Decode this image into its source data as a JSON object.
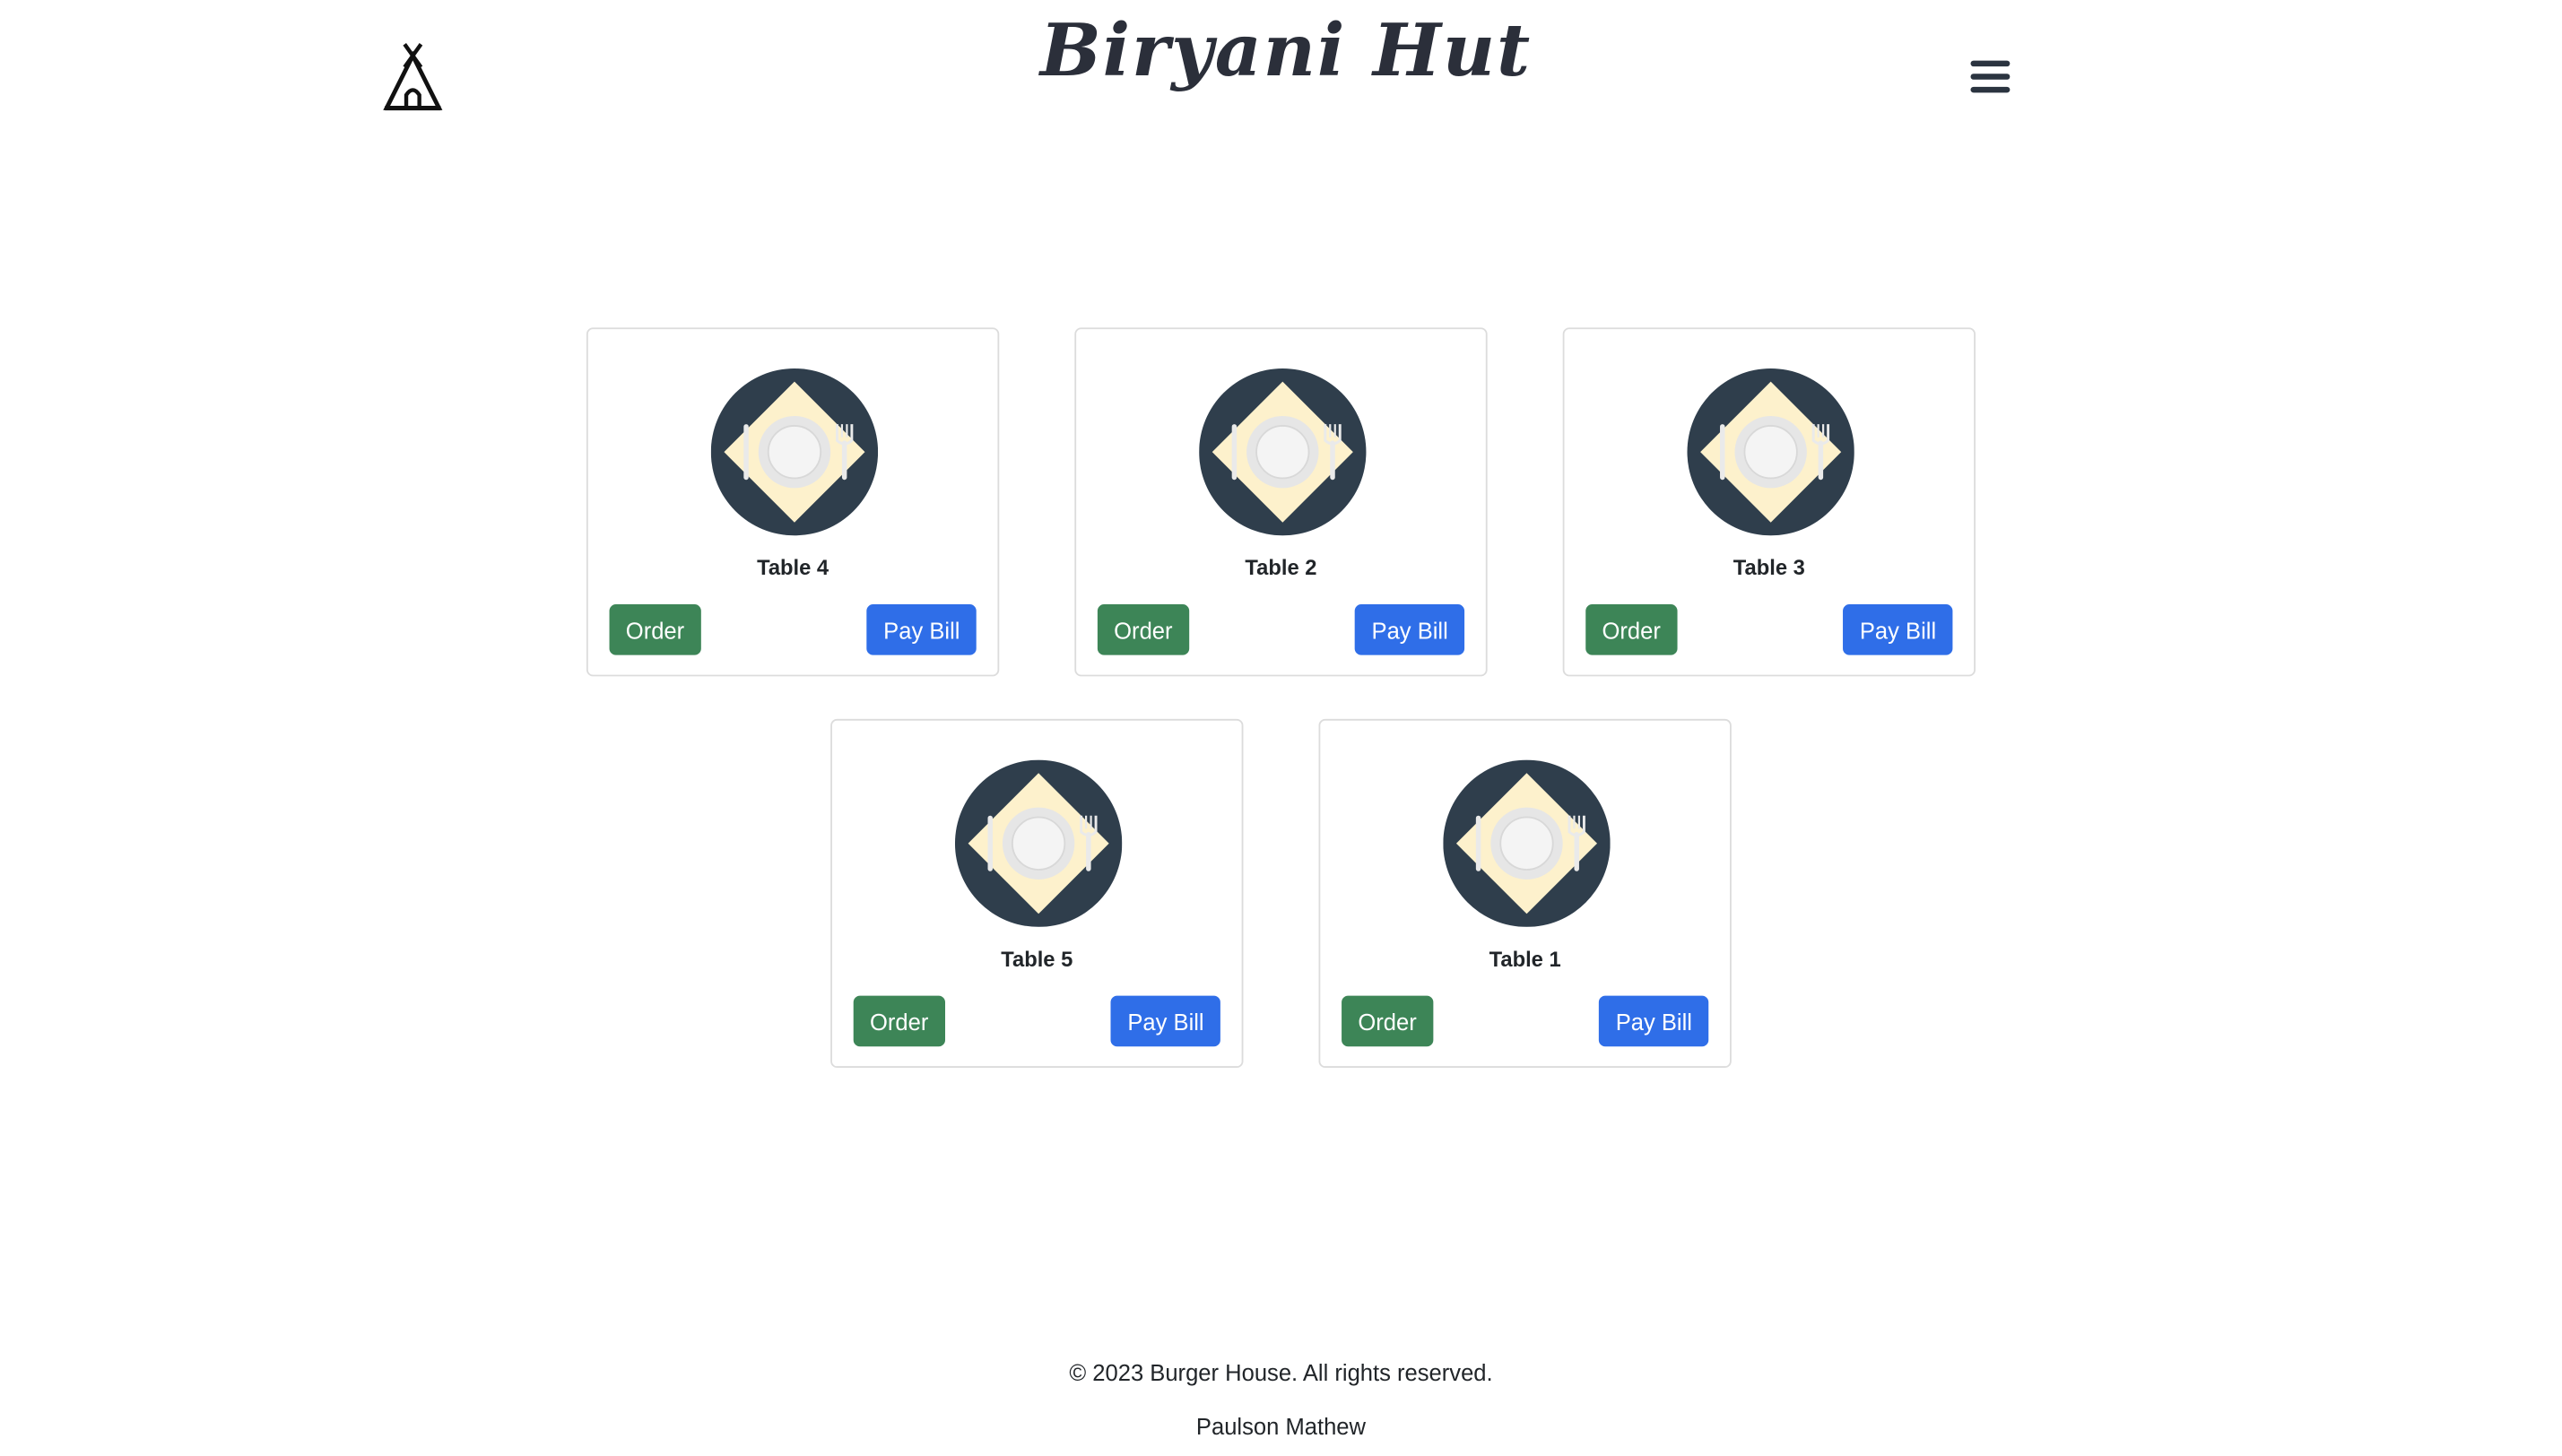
{
  "brand": {
    "title": "Biryani Hut",
    "logo_icon": "tent-icon",
    "menu_icon": "hamburger-menu-icon"
  },
  "colors": {
    "order_button": "#3d8557",
    "pay_button": "#2f6ee8",
    "plate_background": "#2f3e4c",
    "napkin": "#fdf1cc"
  },
  "tables": [
    {
      "name": "Table 4",
      "order_label": "Order",
      "pay_label": "Pay Bill",
      "icon": "table-setting-icon"
    },
    {
      "name": "Table 2",
      "order_label": "Order",
      "pay_label": "Pay Bill",
      "icon": "table-setting-icon"
    },
    {
      "name": "Table 3",
      "order_label": "Order",
      "pay_label": "Pay Bill",
      "icon": "table-setting-icon"
    },
    {
      "name": "Table 5",
      "order_label": "Order",
      "pay_label": "Pay Bill",
      "icon": "table-setting-icon"
    },
    {
      "name": "Table 1",
      "order_label": "Order",
      "pay_label": "Pay Bill",
      "icon": "table-setting-icon"
    }
  ],
  "footer": {
    "copyright": "© 2023 Burger House. All rights reserved.",
    "author": "Paulson Mathew"
  }
}
